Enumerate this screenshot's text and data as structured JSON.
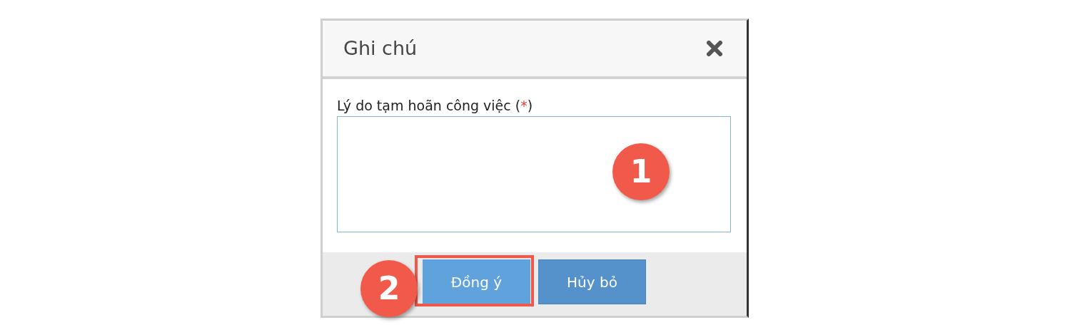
{
  "dialog": {
    "title": "Ghi chú",
    "field": {
      "label_prefix": "Lý do tạm hoãn công việc (",
      "required_mark": "*",
      "label_suffix": ")"
    },
    "buttons": [
      {
        "label": "Đồng ý",
        "kind": "primary",
        "highlighted": true
      },
      {
        "label": "Hủy bỏ",
        "kind": "secondary",
        "highlighted": false
      }
    ]
  },
  "annotations": [
    {
      "text": "1",
      "kind": "field"
    },
    {
      "text": "2",
      "kind": "button"
    }
  ]
}
